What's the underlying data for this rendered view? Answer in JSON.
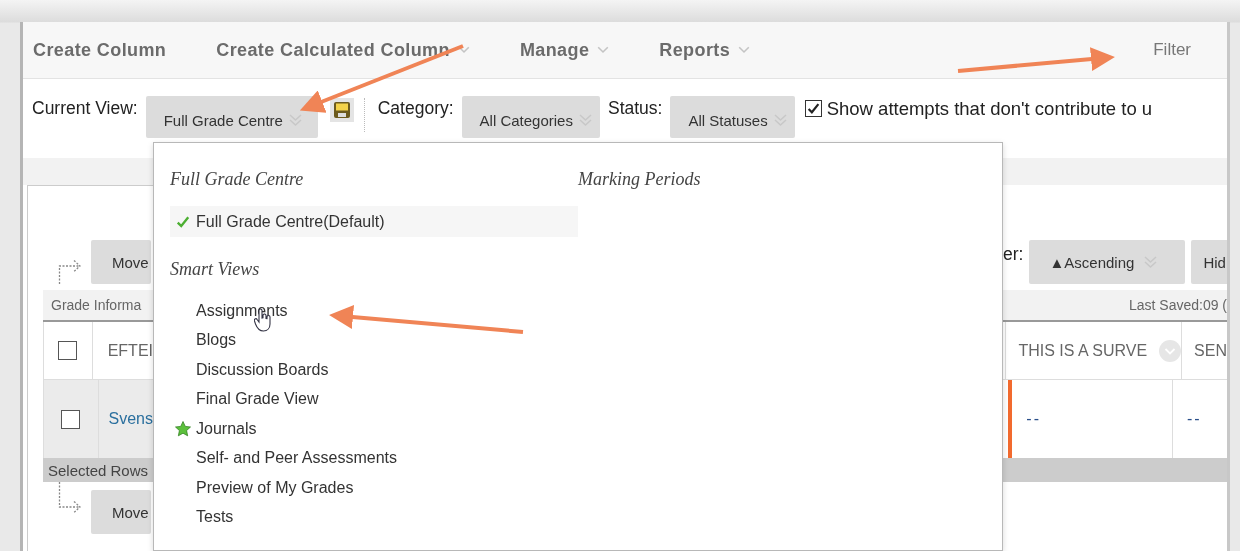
{
  "action_bar": {
    "items": [
      {
        "label": "Create Column",
        "has_menu": false
      },
      {
        "label": "Create Calculated Column",
        "has_menu": true
      },
      {
        "label": "Manage",
        "has_menu": true
      },
      {
        "label": "Reports",
        "has_menu": true
      }
    ],
    "filter": "Filter"
  },
  "view_bar": {
    "current_view_label": "Current View:",
    "current_view": "Full Grade Centre",
    "category_label": "Category:",
    "category": "All Categories",
    "status_label": "Status:",
    "status": "All Statuses",
    "show_attempts": {
      "label": "Show attempts that don't contribute to u",
      "checked": true
    }
  },
  "view_menu": {
    "sections": [
      {
        "heading": "Full Grade Centre",
        "items": [
          {
            "label": "Full Grade Centre(Default)",
            "selected": true,
            "favorite": false,
            "hovered": false
          }
        ]
      },
      {
        "heading": "Smart Views",
        "items": [
          {
            "label": "Assignments",
            "selected": false,
            "favorite": false,
            "hovered": true
          },
          {
            "label": "Blogs",
            "selected": false,
            "favorite": false,
            "hovered": false
          },
          {
            "label": "Discussion Boards",
            "selected": false,
            "favorite": false,
            "hovered": false
          },
          {
            "label": "Final Grade View",
            "selected": false,
            "favorite": false,
            "hovered": false
          },
          {
            "label": "Journals",
            "selected": false,
            "favorite": true,
            "hovered": false
          },
          {
            "label": "Self- and Peer Assessments",
            "selected": false,
            "favorite": false,
            "hovered": false
          },
          {
            "label": "Preview of My Grades",
            "selected": false,
            "favorite": false,
            "hovered": false
          },
          {
            "label": "Tests",
            "selected": false,
            "favorite": false,
            "hovered": false
          }
        ]
      }
    ],
    "marking_periods": "Marking Periods"
  },
  "grade_centre": {
    "move_button": "Move",
    "sort_label": "er:",
    "sort_button": "▲Ascending",
    "hide_button": "Hid",
    "info_bar": "Grade Informa",
    "last_saved": "Last Saved:09 (",
    "select_all_checked": false,
    "columns_left": [
      "EFTEI"
    ],
    "columns_right": [
      "THIS IS A SURVE",
      "SEN"
    ],
    "row": {
      "checked": false,
      "name": "Svens",
      "cells_right": [
        "--",
        "--"
      ]
    },
    "selected_rows": "Selected Rows",
    "bottom_move_button": "Move"
  }
}
